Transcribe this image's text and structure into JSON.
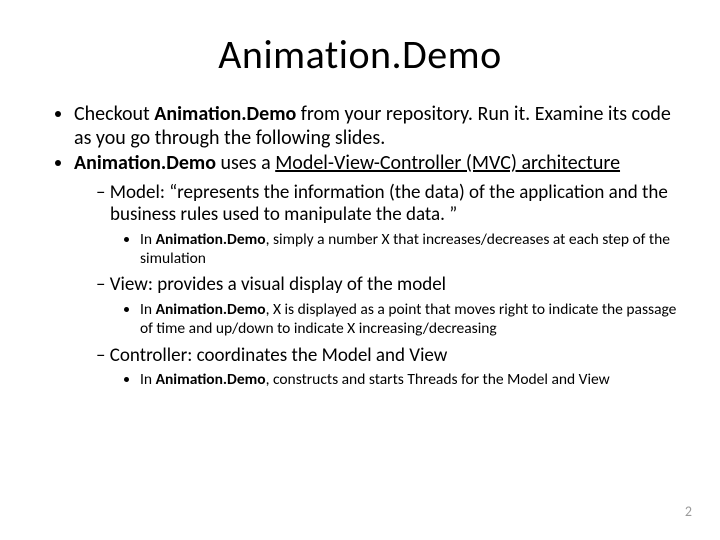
{
  "title": "Animation.Demo",
  "bullets": {
    "b1_pre": "Checkout ",
    "b1_bold": "Animation.Demo",
    "b1_post": " from your repository.  Run it.  Examine its code as you go through the following slides.",
    "b2_bold": "Animation.Demo",
    "b2_mid": " uses a ",
    "b2_link": "Model-View-Controller (MVC) architecture",
    "sub1_label": "Model:  ",
    "sub1_text": "“represents the information (the data) of the application and the business rules used to manipulate the data. ”",
    "sub1_det_pre": "In ",
    "sub1_det_bold": "Animation.Demo",
    "sub1_det_post": ", simply a number X that increases/decreases at each step of the simulation",
    "sub2_label": "View:  ",
    "sub2_text": "provides a visual display of the model",
    "sub2_det_pre": "In ",
    "sub2_det_bold": "Animation.Demo",
    "sub2_det_post": ", X is displayed as a point that moves right to indicate the passage of time and up/down to indicate X increasing/decreasing",
    "sub3_label": "Controller:  ",
    "sub3_text": "coordinates the Model and View",
    "sub3_det_pre": "In ",
    "sub3_det_bold": "Animation.Demo",
    "sub3_det_post": ", constructs and starts Threads for the Model and View"
  },
  "page_number": "2"
}
